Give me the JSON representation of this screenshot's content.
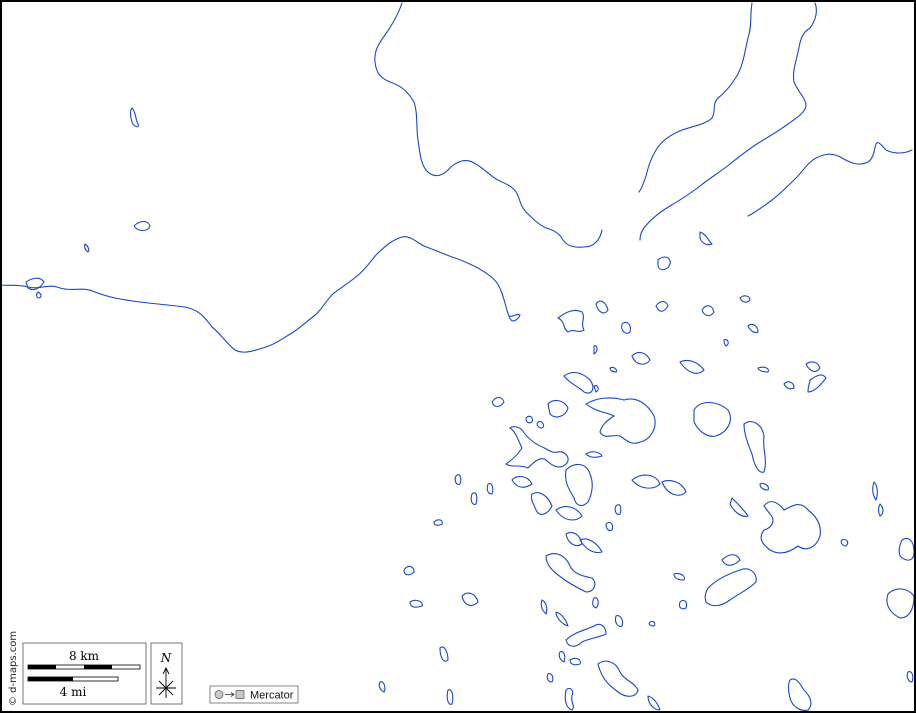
{
  "map": {
    "credit": "© d-maps.com",
    "projection": "Mercator",
    "north_label": "N",
    "scale": {
      "km_label": "8 km",
      "mi_label": "4 mi"
    },
    "colors": {
      "water_outline": "#1848c8",
      "background": "#ffffff",
      "frame": "#000000"
    },
    "icons": {
      "north_arrow": "compass-rose-icon",
      "projection": "globe-to-square-icon"
    }
  }
}
